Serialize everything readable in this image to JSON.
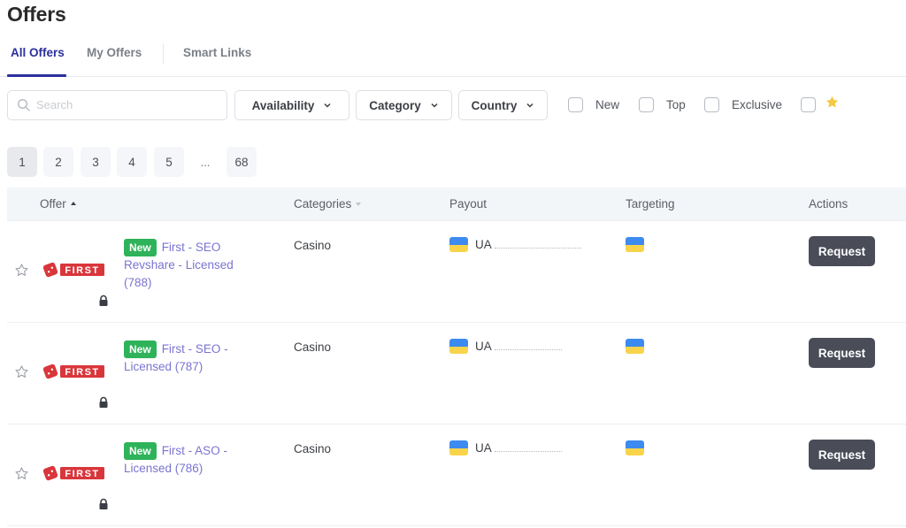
{
  "page": {
    "title": "Offers"
  },
  "tabs": [
    {
      "label": "All Offers",
      "active": true
    },
    {
      "label": "My Offers",
      "active": false
    },
    {
      "label": "Smart Links",
      "active": false
    }
  ],
  "filters": {
    "search": {
      "placeholder": "Search",
      "value": "",
      "icon": "search-icon"
    },
    "dropdowns": [
      {
        "label": "Availability",
        "icon": "chevron-down-icon"
      },
      {
        "label": "Category",
        "icon": "chevron-down-icon"
      },
      {
        "label": "Country",
        "icon": "chevron-down-icon"
      }
    ],
    "checkboxes": [
      {
        "label": "New",
        "checked": false
      },
      {
        "label": "Top",
        "checked": false
      },
      {
        "label": "Exclusive",
        "checked": false
      },
      {
        "label": "",
        "icon": "star-icon",
        "checked": false
      }
    ],
    "star_color": "#f5c842"
  },
  "pagination": {
    "pages": [
      "1",
      "2",
      "3",
      "4",
      "5"
    ],
    "ellipsis": "...",
    "last": "68",
    "current": "1"
  },
  "table": {
    "columns": [
      {
        "label": "Offer",
        "sort": "asc"
      },
      {
        "label": "Categories",
        "sort": "none"
      },
      {
        "label": "Payout"
      },
      {
        "label": "Targeting"
      },
      {
        "label": "Actions"
      }
    ],
    "rows": [
      {
        "badge": "New",
        "brand": "FIRST",
        "title": "First - SEO Revshare - Licensed (788)",
        "category": "Casino",
        "payout_country": "UA",
        "targeting": "UA",
        "locked": true,
        "action": "Request"
      },
      {
        "badge": "New",
        "brand": "FIRST",
        "title": "First - SEO - Licensed (787)",
        "category": "Casino",
        "payout_country": "UA",
        "targeting": "UA",
        "locked": true,
        "action": "Request"
      },
      {
        "badge": "New",
        "brand": "FIRST",
        "title": "First - ASO - Licensed (786)",
        "category": "Casino",
        "payout_country": "UA",
        "targeting": "UA",
        "locked": true,
        "action": "Request"
      }
    ]
  },
  "colors": {
    "accent": "#2c2f9c",
    "badge_green": "#2fb35a",
    "link": "#7a74d0",
    "button_dark": "#4a4d58",
    "brand_red": "#d9363b",
    "flag_blue": "#3d8bf0",
    "flag_yellow": "#f9d44a"
  }
}
